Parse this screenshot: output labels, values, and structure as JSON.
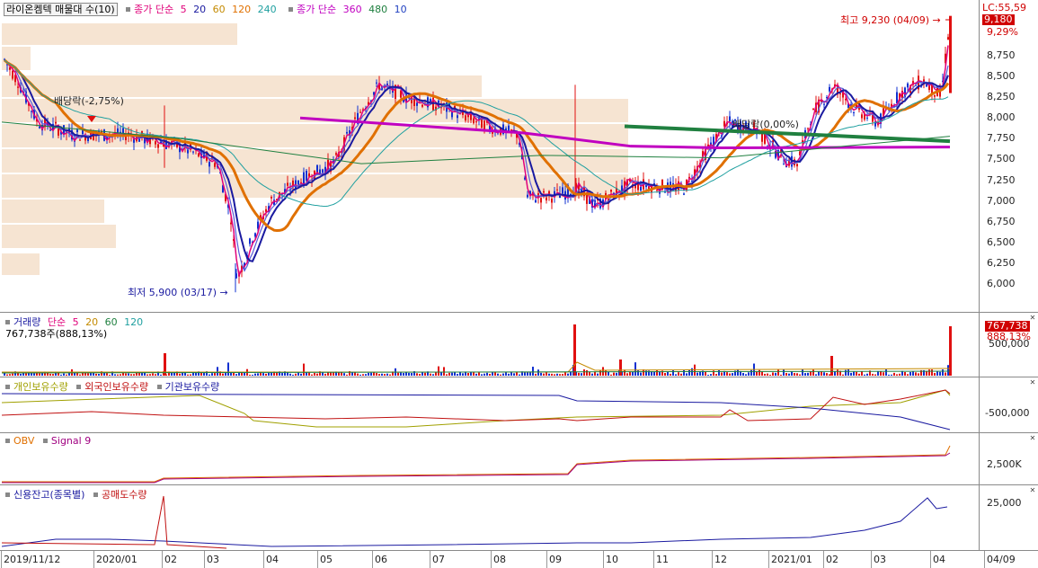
{
  "price": {
    "title": "라이온켐텍 매물대 수(10)",
    "ma_label": "종가 단순",
    "ma_periods": [
      "5",
      "20",
      "60",
      "120",
      "240"
    ],
    "ma_colors": [
      "#e0007a",
      "#1a1aa0",
      "#c48a00",
      "#e07000",
      "#20a0a0"
    ],
    "ma2_label": "종가 단순",
    "ma2_periods": [
      "360",
      "480",
      "10"
    ],
    "ma2_colors": [
      "#c000c0",
      "#208040",
      "#2040c0"
    ],
    "lc": "LC:55,59",
    "last_price": "9,180",
    "last_pct": "9,29%",
    "high_note": "최고 9,230 (04/09)",
    "low_note": "최저 5,900 (03/17)",
    "div1": "배당락(-2,75%)",
    "div2": "배당락(0,00%)",
    "ticks": [
      "8,750",
      "8,500",
      "8,250",
      "8,000",
      "7,750",
      "7,500",
      "7,250",
      "7,000",
      "6,750",
      "6,500",
      "6,250",
      "6,000"
    ],
    "colors": {
      "up": "#e01010",
      "down": "#1030d0",
      "profile": "#f6e4d2"
    }
  },
  "volume": {
    "title": "거래량",
    "ma_label": "단순",
    "periods": [
      "5",
      "20",
      "60",
      "120"
    ],
    "period_colors": [
      "#e0007a",
      "#c48a00",
      "#208040",
      "#20a0a0"
    ],
    "sub": "767,738주(888,13%)",
    "tag_value": "767,738",
    "tag_pct": "888,13%",
    "tick": "500,000"
  },
  "holders": {
    "items": [
      "개인보유수량",
      "외국인보유수량",
      "기관보유수량"
    ],
    "item_colors": [
      "#a0a000",
      "#c01010",
      "#1a1aa0"
    ],
    "tick": "-500,000"
  },
  "obv": {
    "items": [
      "OBV",
      "Signal 9"
    ],
    "item_colors": [
      "#e07000",
      "#a00080"
    ],
    "tick": "2,500K"
  },
  "credit": {
    "items": [
      "신용잔고(종목별)",
      "공매도수량"
    ],
    "item_colors": [
      "#1a1aa0",
      "#c01010"
    ],
    "tick": "25,000"
  },
  "xaxis": {
    "labels": [
      "2019/11/12",
      "2020/01",
      "02",
      "03",
      "04",
      "05",
      "06",
      "07",
      "08",
      "09",
      "10",
      "11",
      "12",
      "2021/01",
      "02",
      "03",
      "04",
      "04/09"
    ]
  }
}
